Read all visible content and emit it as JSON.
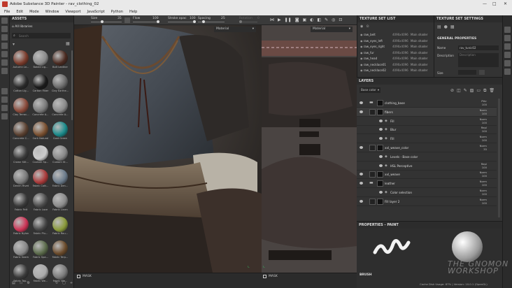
{
  "window": {
    "title": "Adobe Substance 3D Painter - rav_clothing_02",
    "min": "—",
    "max": "□",
    "close": "✕"
  },
  "menu": [
    "File",
    "Edit",
    "Mode",
    "Window",
    "Viewport",
    "JavaScript",
    "Python",
    "Help"
  ],
  "assets": {
    "title": "ASSETS",
    "breadcrumb": "All libraries",
    "search_placeholder": "Search",
    "items": [
      {
        "label": "Autumn Le...",
        "color": "#7a3a2a"
      },
      {
        "label": "Baked Lig...",
        "color": "#8a8a8a"
      },
      {
        "label": "Bolt Leather",
        "color": "#4a2a20"
      },
      {
        "label": "Cotton Lig...",
        "color": "#2a2a2a"
      },
      {
        "label": "Carbon Fiber",
        "color": "#1a1a1a"
      },
      {
        "label": "Clay Earthe...",
        "color": "#6a6a6a"
      },
      {
        "label": "Clay Terrac...",
        "color": "#8a4a3a"
      },
      {
        "label": "Concrete A...",
        "color": "#7a7a7a"
      },
      {
        "label": "Concrete A...",
        "color": "#8a8a8a"
      },
      {
        "label": "Concrete C...",
        "color": "#5a4030"
      },
      {
        "label": "Cork Natural",
        "color": "#7a5030"
      },
      {
        "label": "Coat Green",
        "color": "#1a8a8a"
      },
      {
        "label": "Crown Stit...",
        "color": "#3a3a3a"
      },
      {
        "label": "Custom Sp...",
        "color": "#cccccc"
      },
      {
        "label": "Custom St...",
        "color": "#888888"
      },
      {
        "label": "Denim Rivet",
        "color": "#7a7a7a"
      },
      {
        "label": "Fabric Cott...",
        "color": "#aa3a3a"
      },
      {
        "label": "Fabric Den...",
        "color": "#6a7a8a"
      },
      {
        "label": "Fabric Felt",
        "color": "#3a3a3a"
      },
      {
        "label": "Fabric Lace",
        "color": "#4a4a4a"
      },
      {
        "label": "Fabric Linen",
        "color": "#8a8a8a"
      },
      {
        "label": "Fabric Nylon",
        "color": "#cc3355"
      },
      {
        "label": "Fabric Plu...",
        "color": "#444444"
      },
      {
        "label": "Fabric Rou...",
        "color": "#8a9a3a"
      },
      {
        "label": "Fabric Seam",
        "color": "#888888"
      },
      {
        "label": "Fabric Spa...",
        "color": "#5a6a4a"
      },
      {
        "label": "Fabric Terp...",
        "color": "#6a4a2a"
      },
      {
        "label": "Fabric Top...",
        "color": "#3a3a3a"
      },
      {
        "label": "Fabric We...",
        "color": "#aaaaaa"
      },
      {
        "label": "Fabric We...",
        "color": "#7a7a7a"
      }
    ]
  },
  "toolbar": {
    "size_label": "Size",
    "size_value": "35",
    "flow_label": "Flow",
    "flow_value": "100",
    "stroke_label": "Stroke opac",
    "stroke_value": "100",
    "spacing_label": "Spacing",
    "spacing_value": "25",
    "rotation_label": "Rotation",
    "rotation_value": "0"
  },
  "viewport": {
    "material_left": "Material",
    "material_right": "Material",
    "mask_left": "MASK",
    "mask_right": "MASK"
  },
  "texture_set_list": {
    "title": "TEXTURE SET LIST",
    "rows": [
      {
        "name": "raw_belt",
        "res": "4096x4096",
        "shader": "Main shader"
      },
      {
        "name": "raw_eyes_left",
        "res": "4096x4096",
        "shader": "Main shader"
      },
      {
        "name": "raw_eyes_right",
        "res": "4096x4096",
        "shader": "Main shader"
      },
      {
        "name": "raw_fur",
        "res": "4096x4096",
        "shader": "Main shader"
      },
      {
        "name": "raw_head",
        "res": "4096x4096",
        "shader": "Main shader"
      },
      {
        "name": "raw_necklace01",
        "res": "4096x4096",
        "shader": "Main shader"
      },
      {
        "name": "raw_necklace02",
        "res": "4096x4096",
        "shader": "Main shader"
      }
    ]
  },
  "texture_set_settings": {
    "title": "TEXTURE SET SETTINGS",
    "section": "GENERAL PROPERTIES",
    "name_label": "Name",
    "name_value": "rav_tunic02",
    "desc_label": "Description",
    "desc_placeholder": "Description",
    "size_label": "Size"
  },
  "layers": {
    "title": "LAYERS",
    "channel": "Base color",
    "rows": [
      {
        "name": "clothing_base",
        "blend": "Pthr",
        "opacity": "100",
        "indent": 0,
        "kind": "folder"
      },
      {
        "name": "fibers",
        "blend": "Norm",
        "opacity": "100",
        "indent": 0,
        "kind": "fill"
      },
      {
        "name": "Fill",
        "blend": "Norm",
        "opacity": "100",
        "indent": 1,
        "kind": "effect"
      },
      {
        "name": "Blur",
        "blend": "Repl",
        "opacity": "100",
        "indent": 1,
        "kind": "effect"
      },
      {
        "name": "Fill",
        "blend": "Norm",
        "opacity": "100",
        "indent": 1,
        "kind": "effect"
      },
      {
        "name": "xxl_weave_color",
        "blend": "Norm",
        "opacity": "35",
        "indent": 0,
        "kind": "fill"
      },
      {
        "name": "Levels - Base color",
        "blend": "",
        "opacity": "",
        "indent": 1,
        "kind": "effect"
      },
      {
        "name": "HSL Perceptive",
        "blend": "Repl",
        "opacity": "100",
        "indent": 1,
        "kind": "effect"
      },
      {
        "name": "xxl_weave",
        "blend": "Norm",
        "opacity": "100",
        "indent": 0,
        "kind": "fill"
      },
      {
        "name": "leather",
        "blend": "Norm",
        "opacity": "100",
        "indent": 0,
        "kind": "folder"
      },
      {
        "name": "Color selection",
        "blend": "Norm",
        "opacity": "100",
        "indent": 1,
        "kind": "effect"
      },
      {
        "name": "Fill layer 2",
        "blend": "Norm",
        "opacity": "100",
        "indent": 0,
        "kind": "fill"
      }
    ]
  },
  "properties": {
    "title": "PROPERTIES - PAINT",
    "brush": "BRUSH"
  },
  "watermark": {
    "line1": "THE GNOMON",
    "line2": "WORKSHOP"
  },
  "status": "Cache Disk Usage: 87% | Version: 10.0.1 (OpenGL)"
}
